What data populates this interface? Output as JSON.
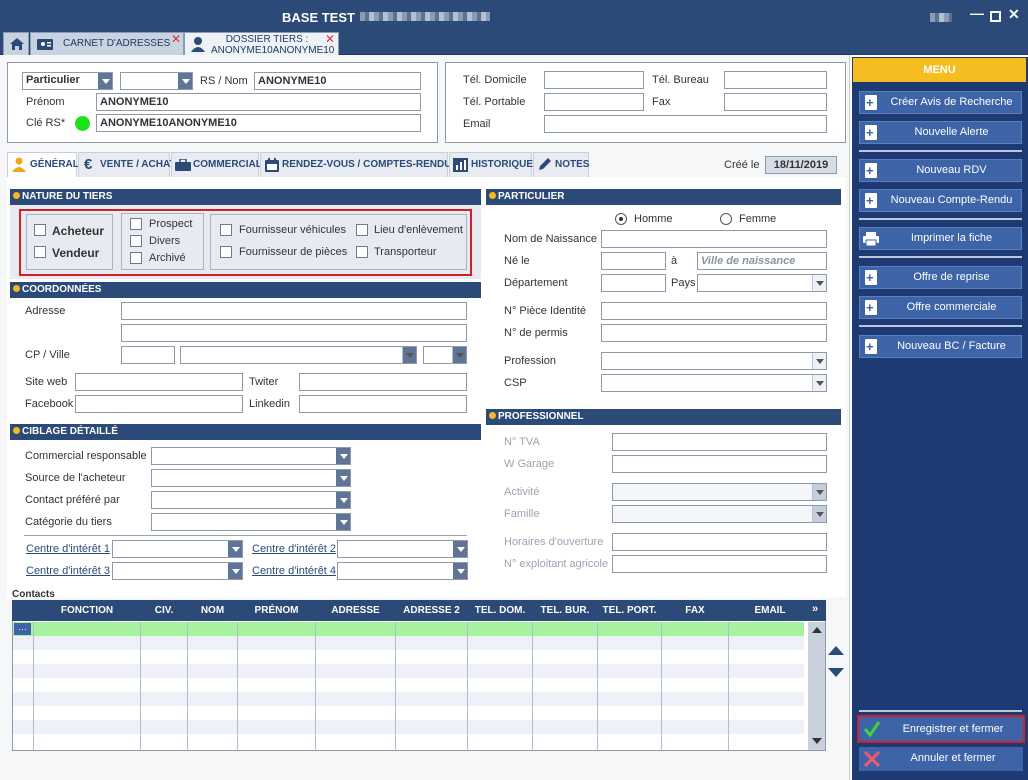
{
  "window": {
    "title": "BASE TEST"
  },
  "tabs": [
    {
      "label": "CARNET D'ADRESSES"
    },
    {
      "label_line1": "DOSSIER TIERS :",
      "label_line2": "ANONYME10ANONYME10"
    }
  ],
  "identity": {
    "type_value": "Particulier",
    "rs_nom_label": "RS / Nom",
    "rs_nom_value": "ANONYME10",
    "prenom_label": "Prénom",
    "prenom_value": "ANONYME10",
    "cle_rs_label": "Clé RS*",
    "cle_rs_value": "ANONYME10ANONYME10",
    "status_color": "#19e319"
  },
  "phones": {
    "tel_domicile_label": "Tél. Domicile",
    "tel_bureau_label": "Tél. Bureau",
    "tel_portable_label": "Tél. Portable",
    "fax_label": "Fax",
    "email_label": "Email"
  },
  "nav_tabs": [
    {
      "label": "GÉNÉRAL",
      "icon": "user-icon"
    },
    {
      "label": "VENTE / ACHAT",
      "icon": "euro-icon"
    },
    {
      "label": "COMMERCIAL",
      "icon": "briefcase-icon"
    },
    {
      "label": "RENDEZ-VOUS / COMPTES-RENDUS",
      "icon": "calendar-icon"
    },
    {
      "label": "HISTORIQUE",
      "icon": "chart-icon"
    },
    {
      "label": "NOTES",
      "icon": "pencil-icon"
    }
  ],
  "created": {
    "label": "Créé le",
    "date": "18/11/2019"
  },
  "nature": {
    "header": "NATURE DU TIERS",
    "acheteur": "Acheteur",
    "vendeur": "Vendeur",
    "prospect": "Prospect",
    "divers": "Divers",
    "archive": "Archivé",
    "fournisseur_vehicules": "Fournisseur véhicules",
    "fournisseur_pieces": "Fournisseur de pièces",
    "lieu_enlevement": "Lieu d'enlèvement",
    "transporteur": "Transporteur"
  },
  "coordonnees": {
    "header": "COORDONNÉES",
    "adresse": "Adresse",
    "cp_ville": "CP / Ville",
    "site_web": "Site web",
    "twitter": "Twiter",
    "facebook": "Facebook",
    "linkedin": "Linkedin"
  },
  "ciblage": {
    "header": "CIBLAGE DÉTAILLÉ",
    "commercial": "Commercial responsable",
    "source": "Source de l'acheteur",
    "contact": "Contact préféré par",
    "categorie": "Catégorie du tiers",
    "ci1": "Centre d'intérêt 1",
    "ci2": "Centre d'intérêt 2",
    "ci3": "Centre d'intérêt 3",
    "ci4": "Centre d'intérêt 4"
  },
  "particulier": {
    "header": "PARTICULIER",
    "homme": "Homme",
    "femme": "Femme",
    "nom_naissance": "Nom de Naissance",
    "ne_le": "Né le",
    "a": "à",
    "ville_placeholder": "Ville de naissance",
    "departement": "Département",
    "pays": "Pays",
    "piece_identite": "N° Pièce Identité",
    "permis": "N° de permis",
    "profession": "Profession",
    "csp": "CSP"
  },
  "professionnel": {
    "header": "PROFESSIONNEL",
    "tva": "N° TVA",
    "garage": "W Garage",
    "activite": "Activité",
    "famille": "Famille",
    "horaires": "Horaires d'ouverture",
    "exploitant": "N° exploitant agricole"
  },
  "contacts": {
    "title": "Contacts",
    "columns": [
      "FONCTION",
      "CIV.",
      "NOM",
      "PRÉNOM",
      "ADRESSE",
      "ADRESSE 2",
      "TEL. DOM.",
      "TEL. BUR.",
      "TEL. PORT.",
      "FAX",
      "EMAIL"
    ],
    "row_button": "…"
  },
  "menu": {
    "title": "MENU",
    "items": [
      {
        "label": "Créer Avis de Recherche"
      },
      {
        "label": "Nouvelle Alerte"
      },
      {
        "label": "Nouveau RDV"
      },
      {
        "label": "Nouveau Compte-Rendu"
      },
      {
        "label": "Imprimer la fiche"
      },
      {
        "label": "Offre de reprise"
      },
      {
        "label": "Offre commerciale"
      },
      {
        "label": "Nouveau BC / Facture"
      }
    ],
    "save": "Enregistrer et fermer",
    "cancel": "Annuler et fermer"
  },
  "colors": {
    "header_blue": "#2b4a78",
    "menu_blue": "#1e3a72",
    "menu_button": "#3e64a8",
    "menu_title": "#f5bd1f",
    "highlight_red": "#d0202a",
    "grid_selected": "#a6f29f"
  }
}
